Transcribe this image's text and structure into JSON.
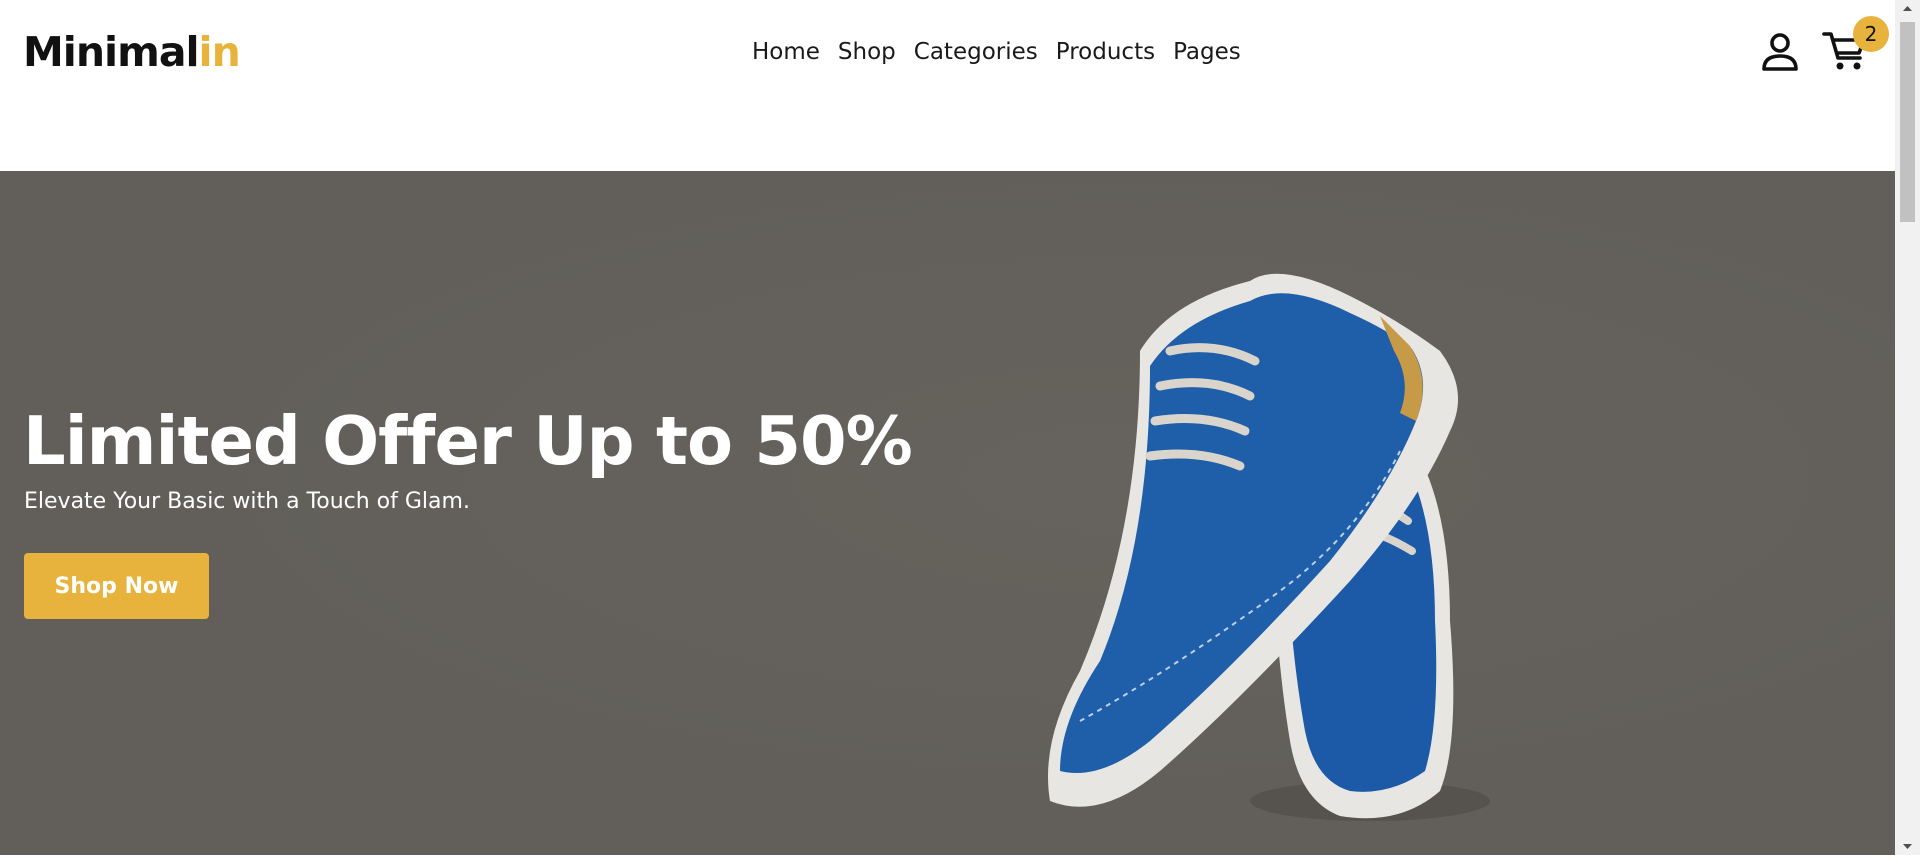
{
  "brand": {
    "name_main": "Minimal",
    "name_accent": "in",
    "accent_color": "#e8b33c"
  },
  "nav": {
    "items": [
      {
        "label": "Home"
      },
      {
        "label": "Shop"
      },
      {
        "label": "Categories"
      },
      {
        "label": "Products"
      },
      {
        "label": "Pages"
      }
    ]
  },
  "header_actions": {
    "account_icon": "user-icon",
    "cart_icon": "shopping-cart-icon",
    "cart_count": "2"
  },
  "hero": {
    "title": "Limited Offer Up to 50%",
    "subtitle": "Elevate Your Basic with a Touch of Glam.",
    "cta_label": "Shop Now",
    "background_color": "#625f5a",
    "image_subject": "pair of blue suede shoes with white soles"
  }
}
